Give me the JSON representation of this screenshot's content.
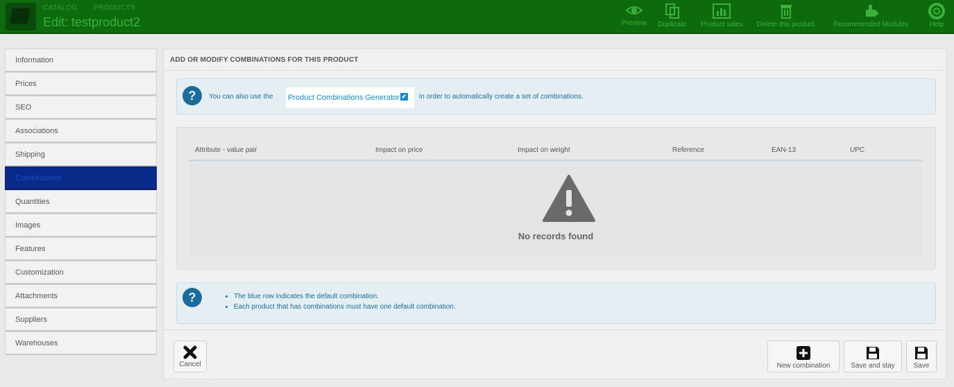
{
  "header": {
    "breadcrumb": [
      "CATALOG",
      "PRODUCTS"
    ],
    "title": "Edit: testproduct2",
    "toolbar": [
      {
        "label": "Preview",
        "icon": "eye-icon"
      },
      {
        "label": "Duplicate",
        "icon": "copy-icon"
      },
      {
        "label": "Product sales",
        "icon": "chart-icon"
      },
      {
        "label": "Delete this product",
        "icon": "trash-icon"
      },
      {
        "label": "Recommended Modules",
        "icon": "puzzle-icon"
      },
      {
        "label": "Help",
        "icon": "lifebuoy-icon"
      }
    ]
  },
  "sidebar": {
    "items": [
      {
        "label": "Information"
      },
      {
        "label": "Prices"
      },
      {
        "label": "SEO"
      },
      {
        "label": "Associations"
      },
      {
        "label": "Shipping"
      },
      {
        "label": "Combinations",
        "active": true
      },
      {
        "label": "Quantities"
      },
      {
        "label": "Images"
      },
      {
        "label": "Features"
      },
      {
        "label": "Customization"
      },
      {
        "label": "Attachments"
      },
      {
        "label": "Suppliers"
      },
      {
        "label": "Warehouses"
      }
    ]
  },
  "main": {
    "panel_title": "ADD OR MODIFY COMBINATIONS FOR THIS PRODUCT",
    "info": {
      "prefix": "You can also use the",
      "link": "Product Combinations Generator",
      "suffix": "in order to automatically create a set of combinations."
    },
    "table": {
      "headers": [
        "Attribute - value pair",
        "Impact on price",
        "Impact on weight",
        "Reference",
        "EAN-13",
        "UPC"
      ],
      "empty_text": "No records found"
    },
    "help_items": [
      "The blue row indicates the default combination.",
      "Each product that has combinations must have one default combination."
    ],
    "footer": {
      "cancel": "Cancel",
      "new_combination": "New combination",
      "save_and_stay": "Save and stay",
      "save": "Save"
    }
  },
  "colors": {
    "header_bg": "#0d6b0d",
    "active_tab_bg": "#0a2a8a",
    "link": "#1a8bc6",
    "info_text": "#1b6c9a"
  }
}
